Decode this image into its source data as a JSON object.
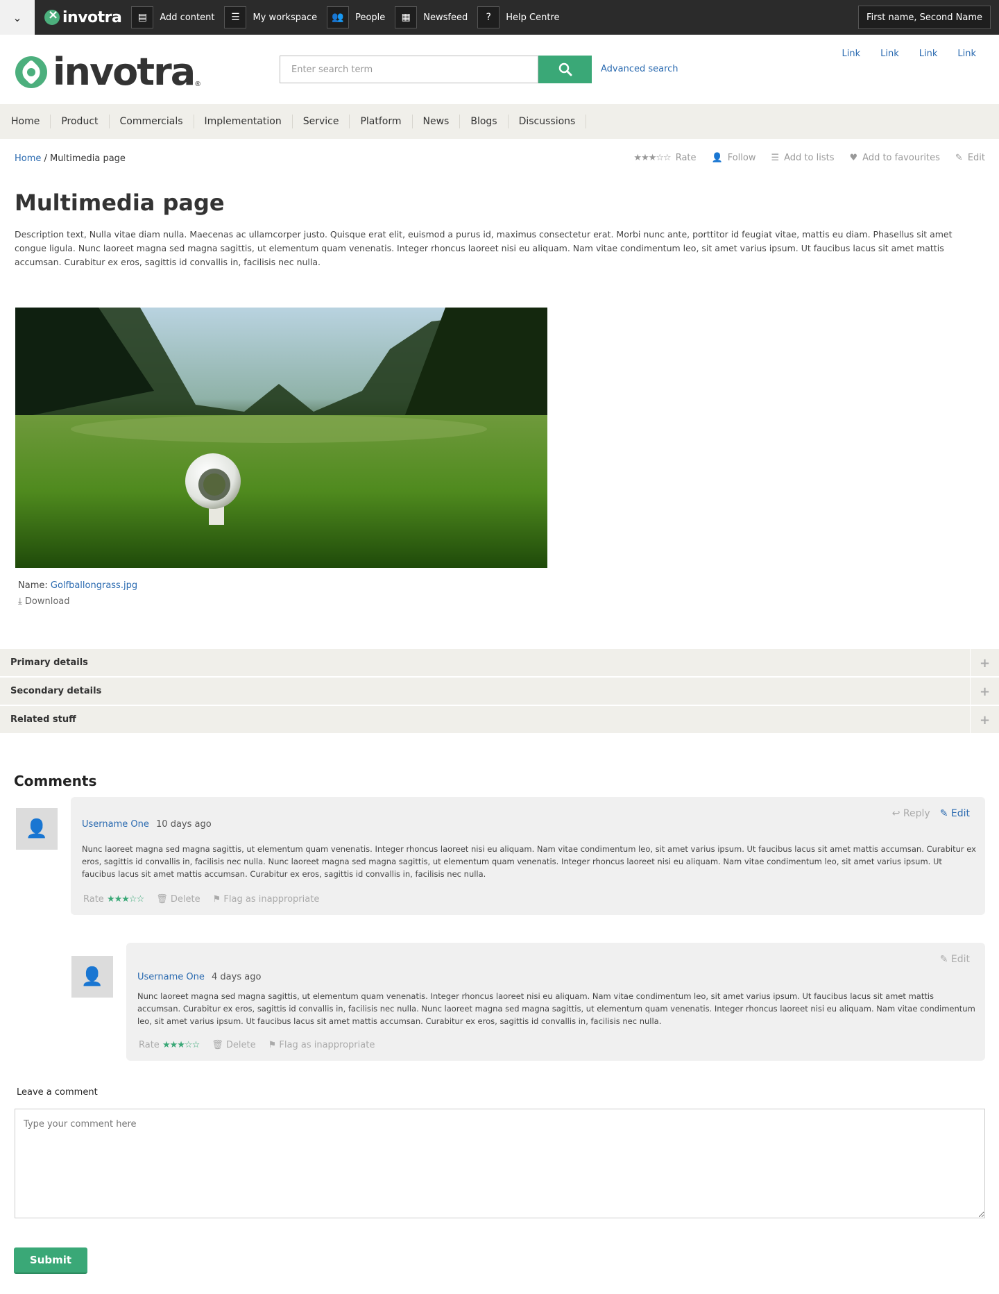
{
  "topbar": {
    "brand": "invotra",
    "items": [
      {
        "label": "Add content",
        "icon": "document-icon"
      },
      {
        "label": "My workspace",
        "icon": "list-icon"
      },
      {
        "label": "People",
        "icon": "people-icon"
      },
      {
        "label": "Newsfeed",
        "icon": "newspaper-icon"
      },
      {
        "label": "Help Centre",
        "icon": "help-icon"
      }
    ],
    "user": "First name, Second Name"
  },
  "header": {
    "brand": "invotra",
    "search_placeholder": "Enter search term",
    "advanced": "Advanced search",
    "links": [
      "Link",
      "Link",
      "Link",
      "Link"
    ]
  },
  "nav": [
    "Home",
    "Product",
    "Commercials",
    "Implementation",
    "Service",
    "Platform",
    "News",
    "Blogs",
    "Discussions"
  ],
  "breadcrumb": {
    "home": "Home",
    "current": "/ Multimedia page"
  },
  "actions": {
    "rate": "Rate",
    "follow": "Follow",
    "lists": "Add to lists",
    "favourites": "Add to favourites",
    "edit": "Edit"
  },
  "page": {
    "title": "Multimedia page",
    "description": "Description text, Nulla vitae diam nulla. Maecenas ac ullamcorper justo. Quisque erat elit, euismod a purus id, maximus consectetur erat. Morbi nunc ante, porttitor id feugiat vitae, mattis eu diam. Phasellus sit amet congue ligula. Nunc laoreet magna sed magna sagittis, ut elementum quam venenatis. Integer rhoncus laoreet nisi eu aliquam. Nam vitae condimentum leo, sit amet varius ipsum. Ut faucibus lacus sit amet mattis accumsan. Curabitur ex eros, sagittis id convallis in, facilisis nec nulla."
  },
  "file": {
    "name_label": "Name:",
    "name": "Golfballongrass.jpg",
    "download": "Download"
  },
  "accordion": [
    "Primary details",
    "Secondary details",
    "Related stuff"
  ],
  "comments": {
    "title": "Comments",
    "items": [
      {
        "user": "Username One",
        "time": "10 days ago",
        "text": "Nunc laoreet magna sed magna sagittis, ut elementum quam venenatis. Integer rhoncus laoreet nisi eu aliquam. Nam vitae condimentum leo, sit amet varius ipsum. Ut faucibus lacus sit amet mattis accumsan. Curabitur ex eros, sagittis id convallis in, facilisis nec nulla. Nunc laoreet magna sed magna sagittis, ut elementum quam venenatis. Integer rhoncus laoreet nisi eu aliquam. Nam vitae condimentum leo, sit amet varius ipsum. Ut faucibus lacus sit amet mattis accumsan. Curabitur ex eros, sagittis id convallis in, facilisis nec nulla.",
        "reply": "Reply",
        "edit": "Edit",
        "rate": "Rate",
        "delete": "Delete",
        "flag": "Flag as inappropriate",
        "rating": 3.5
      },
      {
        "user": "Username One",
        "time": "4 days ago",
        "text": "Nunc laoreet magna sed magna sagittis, ut elementum quam venenatis. Integer rhoncus laoreet nisi eu aliquam. Nam vitae condimentum leo, sit amet varius ipsum. Ut faucibus lacus sit amet mattis accumsan. Curabitur ex eros, sagittis id convallis in, facilisis nec nulla. Nunc laoreet magna sed magna sagittis, ut elementum quam venenatis. Integer rhoncus laoreet nisi eu aliquam. Nam vitae condimentum leo, sit amet varius ipsum. Ut faucibus lacus sit amet mattis accumsan. Curabitur ex eros, sagittis id convallis in, facilisis nec nulla.",
        "edit": "Edit",
        "rate": "Rate",
        "delete": "Delete",
        "flag": "Flag as inappropriate",
        "rating": 3.5
      }
    ]
  },
  "form": {
    "label": "Leave a comment",
    "placeholder": "Type your comment here",
    "submit": "Submit"
  },
  "colors": {
    "accent": "#3aa877",
    "link": "#2a6ab0",
    "bar": "#2b2b2b",
    "nav_bg": "#f0efea"
  }
}
